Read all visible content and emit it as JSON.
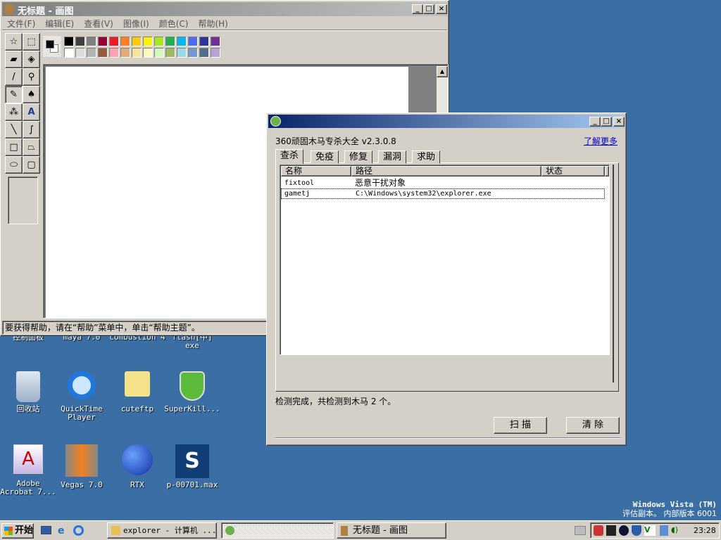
{
  "desktop": {
    "bg": "#3a6ea5",
    "partial_labels": [
      "控制面板",
      "maya 7.0",
      "combustion 4",
      "flash[中]",
      "exe"
    ],
    "icons": [
      {
        "label": "回收站",
        "icon": "recycle-bin-icon"
      },
      {
        "label": "QuickTime Player",
        "icon": "quicktime-icon"
      },
      {
        "label": "cuteftp",
        "icon": "cuteftp-folder-icon"
      },
      {
        "label": "SuperKill...",
        "icon": "superkill-shield-icon"
      },
      {
        "label": "Adobe Acrobat 7...",
        "icon": "acrobat-icon"
      },
      {
        "label": "Vegas 7.0",
        "icon": "vegas-icon"
      },
      {
        "label": "RTX",
        "icon": "rtx-icon"
      },
      {
        "label": "p-00701.max",
        "icon": "3dsmax-icon"
      }
    ],
    "watermark": {
      "line1": "Windows Vista (TM)",
      "line2": "评估副本。 内部版本 6001"
    }
  },
  "paint": {
    "title": "无标题 - 画图",
    "menu": [
      "文件(F)",
      "编辑(E)",
      "查看(V)",
      "图像(I)",
      "颜色(C)",
      "帮助(H)"
    ],
    "tools": [
      "free-select-icon",
      "rect-select-icon",
      "eraser-icon",
      "fill-icon",
      "color-picker-icon",
      "magnifier-icon",
      "pencil-icon",
      "brush-icon",
      "airbrush-icon",
      "text-icon",
      "line-icon",
      "curve-icon",
      "rectangle-icon",
      "polygon-icon",
      "ellipse-icon",
      "rounded-rect-icon"
    ],
    "palette_row1": [
      "#000000",
      "#404040",
      "#808080",
      "#990033",
      "#ed1c24",
      "#ff7f27",
      "#ffc90e",
      "#fff200",
      "#a8e61d",
      "#22b14c",
      "#00b7ef",
      "#4d6df3",
      "#2f3699",
      "#6f3198"
    ],
    "palette_row2": [
      "#ffffff",
      "#dcdcdc",
      "#b4b4b4",
      "#9c5a3c",
      "#ffa3b1",
      "#e5aa7a",
      "#f5e49c",
      "#fff9bd",
      "#d3f9bc",
      "#9dbb61",
      "#99d9ea",
      "#709ad1",
      "#546d8e",
      "#b5a5d5"
    ],
    "status": "要获得帮助，请在“帮助”菜单中，单击“帮助主题”。"
  },
  "tool360": {
    "heading": "360顽固木马专杀大全 v2.3.0.8",
    "link": "了解更多",
    "tabs": [
      "查杀",
      "免疫",
      "修复",
      "漏洞",
      "求助"
    ],
    "columns": [
      "名称",
      "路径",
      "状态"
    ],
    "rows": [
      {
        "name": "fixtool",
        "path": "恶意干扰对象",
        "status": ""
      },
      {
        "name": "gametj",
        "path": "C:\\Windows\\system32\\explorer.exe",
        "status": ""
      }
    ],
    "status": "检测完成，共检测到木马 2 个。",
    "scan": "扫 描",
    "clear": "清 除"
  },
  "taskbar": {
    "start": "开始",
    "tasks": [
      "explorer - 计算机 ...",
      "",
      "无标题 - 画图"
    ],
    "clock": "23:28"
  }
}
